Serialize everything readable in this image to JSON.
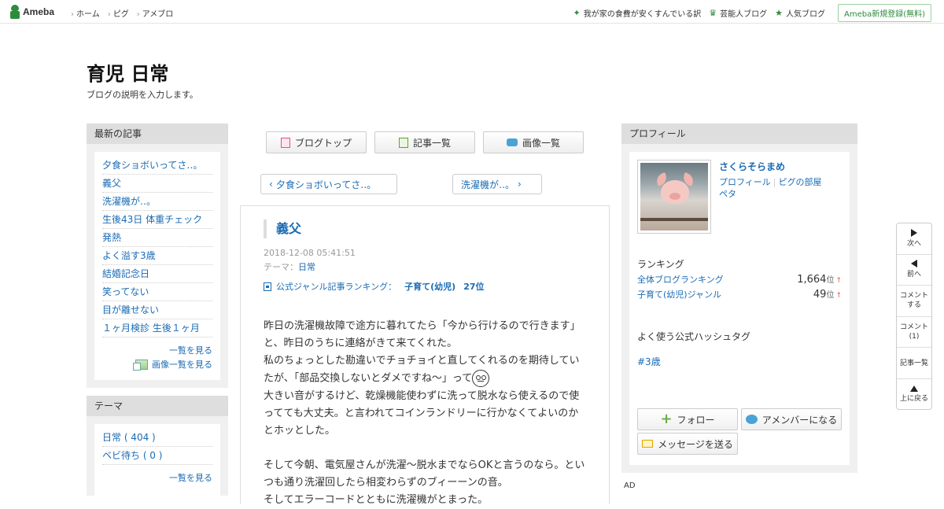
{
  "topbar": {
    "logo": "Ameba",
    "nav": [
      "ホーム",
      "ピグ",
      "アメブロ"
    ],
    "right_links": [
      {
        "icon": "sparkle-icon",
        "label": "我が家の食費が安くすんでいる訳"
      },
      {
        "icon": "crown-icon",
        "label": "芸能人ブログ"
      },
      {
        "icon": "star-icon",
        "label": "人気ブログ"
      }
    ],
    "register": "Ameba新規登録(無料)"
  },
  "blog": {
    "title": "育児 日常",
    "description": "ブログの説明を入力します。"
  },
  "recent": {
    "heading": "最新の記事",
    "items": [
      "夕食ショボいってさ‥。",
      "義父",
      "洗濯機が‥。",
      "生後43日 体重チェック",
      "発熱",
      "よく溢す3歳",
      "結婚記念日",
      "笑ってない",
      "目が離せない",
      "１ヶ月検診 生後１ヶ月"
    ],
    "see_all": "一覧を見る",
    "see_images": "画像一覧を見る"
  },
  "theme": {
    "heading": "テーマ",
    "items": [
      "日常 ( 404 )",
      "ベビ待ち ( 0 )"
    ],
    "see_all": "一覧を見る"
  },
  "center_nav": {
    "blog_top": "ブログトップ",
    "article_list": "記事一覧",
    "image_list": "画像一覧"
  },
  "pager": {
    "prev": "夕食ショボいってさ‥。",
    "next": "洗濯機が‥。"
  },
  "article": {
    "title": "義父",
    "date": "2018-12-08 05:41:51",
    "theme_label": "テーマ：",
    "theme": "日常",
    "rank_label": "公式ジャンル記事ランキング：",
    "rank_genre": "子育て(幼児)",
    "rank_pos": "27位",
    "body": [
      "昨日の洗濯機故障で途方に暮れてたら「今から行けるので行きます」と、昨日のうちに連絡がきて来てくれた。",
      "私のちょっとした勘違いでチョチョイと直してくれるのを期待していたが、「部品交換しないとダメですね～」って",
      "大きい音がするけど、乾燥機能使わずに洗って脱水なら使えるので使ってても大丈夫。と言われてコインランドリーに行かなくてよいのかとホッとした。",
      "",
      "そして今朝、電気屋さんが洗濯～脱水までならOKと言うのなら。といつも通り洗濯回したら相変わらずのブィーーンの音。",
      "そしてエラーコードとともに洗濯機がとまった。"
    ]
  },
  "profile": {
    "heading": "プロフィール",
    "name": "さくらそらまめ",
    "link_profile": "プロフィール",
    "link_pigg": "ピグの部屋",
    "link_pet": "ペタ",
    "ranking_heading": "ランキング",
    "rankings": [
      {
        "label": "全体ブログランキング",
        "value": "1,664",
        "unit": "位",
        "trend": "↑"
      },
      {
        "label": "子育て(幼児)ジャンル",
        "value": "49",
        "unit": "位",
        "trend": "↑"
      }
    ],
    "hashtag_heading": "よく使う公式ハッシュタグ",
    "hashtag": "#3歳",
    "follow": "フォロー",
    "member": "アメンバーになる",
    "message": "メッセージを送る"
  },
  "ad_label": "AD",
  "sidenav": {
    "next": "次へ",
    "prev": "前へ",
    "comment": "コメントする",
    "comment_count": "コメント(1)",
    "list": "記事一覧",
    "top": "上に戻る"
  }
}
